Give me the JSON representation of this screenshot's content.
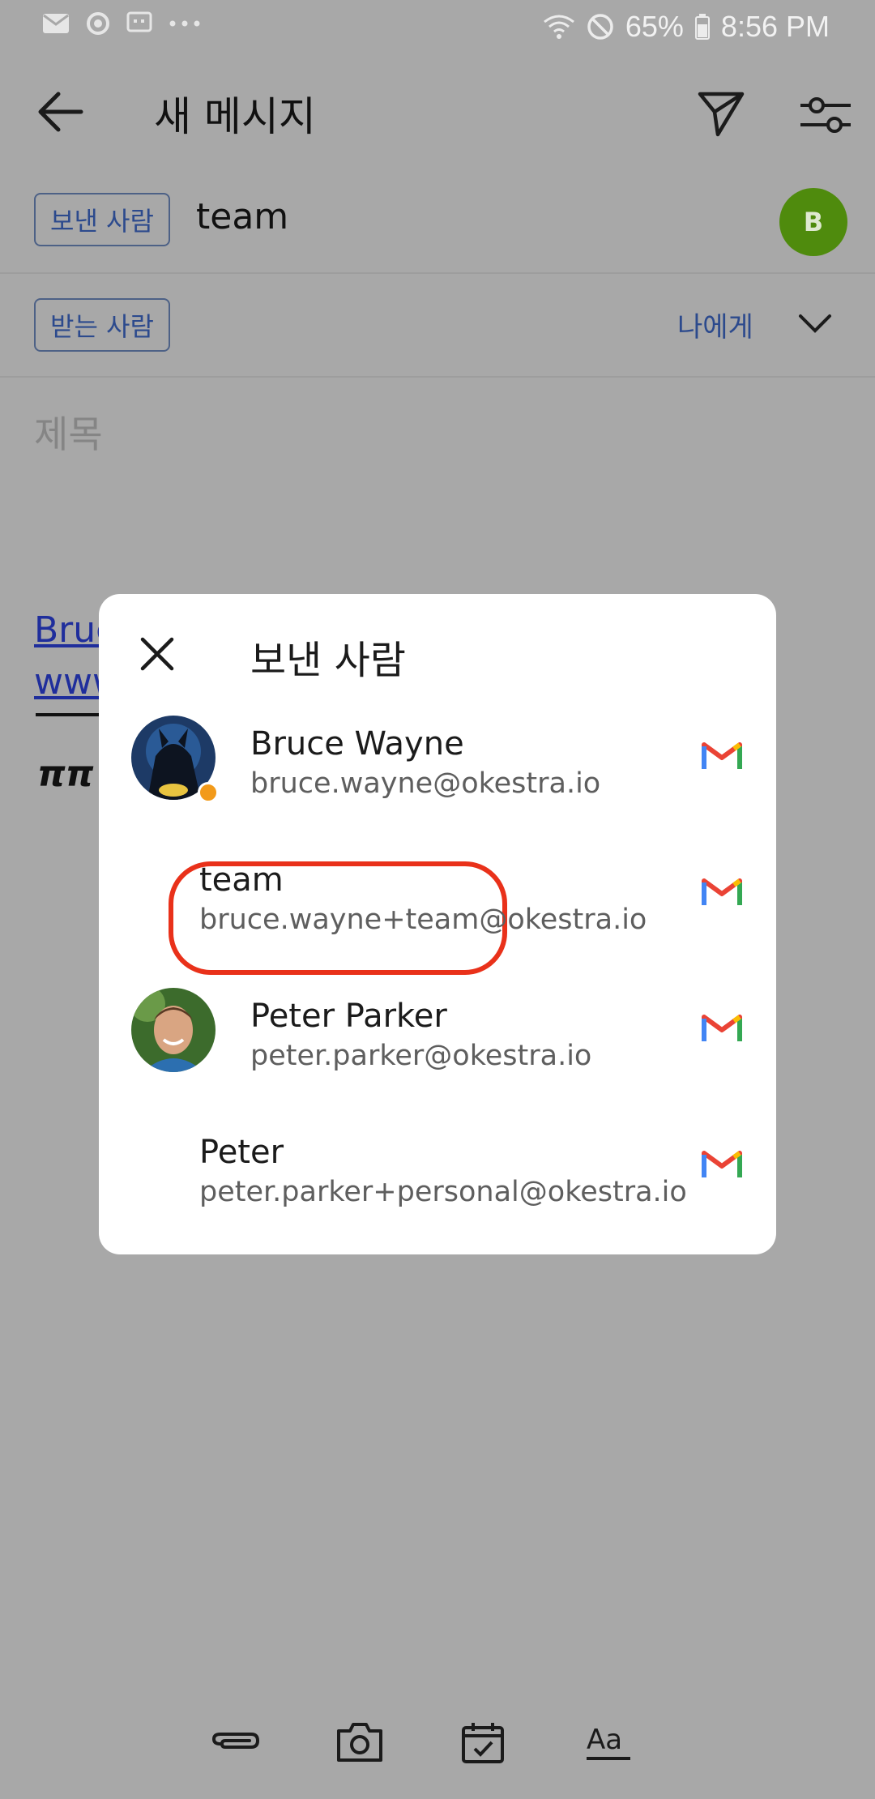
{
  "status_bar": {
    "battery_percent": "65%",
    "time": "8:56 PM",
    "left_icons": [
      "mail-icon",
      "sync-icon",
      "message-icon",
      "more-dots-icon"
    ],
    "right_icons": [
      "wifi-icon",
      "do-not-disturb-icon",
      "battery-icon"
    ]
  },
  "app_bar": {
    "title": "새 메시지",
    "icons": [
      "back-arrow-icon",
      "send-icon",
      "tune-icon"
    ]
  },
  "compose": {
    "from_label": "보낸 사람",
    "from_value": "team",
    "account_avatar_letter": "B",
    "to_label": "받는 사람",
    "to_self_label": "나에게",
    "subject_placeholder": "제목"
  },
  "signature_fragments": {
    "line1": "Bruc",
    "line2": "www",
    "line4": "ππ"
  },
  "dialog": {
    "title": "보낸 사람",
    "items": [
      {
        "name": "Bruce Wayne",
        "email": "bruce.wayne@okestra.io",
        "account_icon": "gmail-icon",
        "avatar": "batman-avatar"
      },
      {
        "name": "team",
        "email": "bruce.wayne+team@okestra.io",
        "account_icon": "gmail-icon",
        "highlighted": true
      },
      {
        "name": "Peter Parker",
        "email": "peter.parker@okestra.io",
        "account_icon": "gmail-icon",
        "avatar": "peter-avatar"
      },
      {
        "name": "Peter",
        "email": "peter.parker+personal@okestra.io",
        "account_icon": "gmail-icon"
      }
    ]
  },
  "toolbar_icons": [
    "attach-icon",
    "camera-icon",
    "calendar-icon",
    "text-format-icon"
  ],
  "colors": {
    "scrim": "#a8a8a8",
    "chip_border": "#4d6186",
    "link": "#2c4a8d",
    "account_avatar": "#4f8b0d",
    "highlight": "#e9311a"
  }
}
